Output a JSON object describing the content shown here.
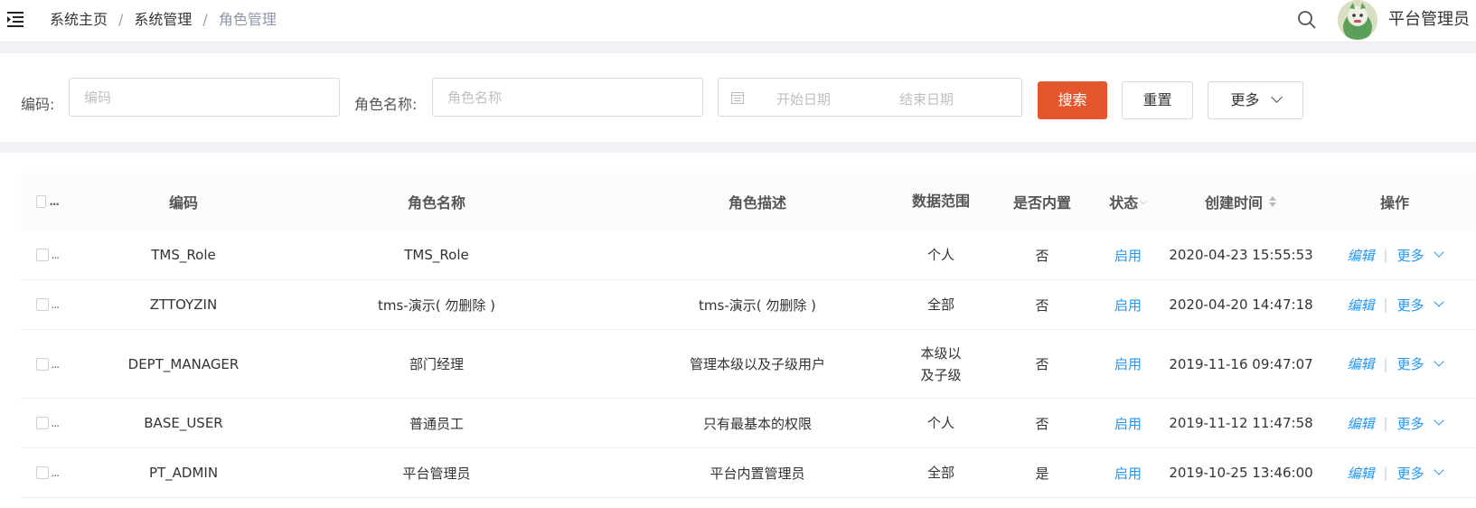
{
  "breadcrumb": {
    "home": "系统主页",
    "system": "系统管理",
    "current": "角色管理",
    "separator": "/"
  },
  "user": {
    "name": "平台管理员"
  },
  "filters": {
    "code_label": "编码:",
    "code_placeholder": "编码",
    "name_label": "角色名称:",
    "name_placeholder": "角色名称",
    "date_start_placeholder": "开始日期",
    "date_end_placeholder": "结束日期",
    "search_button": "搜索",
    "reset_button": "重置",
    "more_button": "更多"
  },
  "table": {
    "headers": {
      "code": "编码",
      "name": "角色名称",
      "desc": "角色描述",
      "range": "数据范围",
      "builtin": "是否内置",
      "status": "状态",
      "created": "创建时间",
      "ops": "操作"
    },
    "row_ellipsis": "...",
    "rows": [
      {
        "code": "TMS_Role",
        "name": "TMS_Role",
        "desc": "",
        "range": "个人",
        "builtin": "否",
        "status": "启用",
        "created": "2020-04-23 15:55:53",
        "edit": "编辑",
        "more": "更多"
      },
      {
        "code": "ZTTOYZIN",
        "name": "tms-演示( 勿删除 )",
        "desc": "tms-演示( 勿删除 )",
        "range": "全部",
        "builtin": "否",
        "status": "启用",
        "created": "2020-04-20 14:47:18",
        "edit": "编辑",
        "more": "更多"
      },
      {
        "code": "DEPT_MANAGER",
        "name": "部门经理",
        "desc": "管理本级以及子级用户",
        "range": "本级以及子级",
        "builtin": "否",
        "status": "启用",
        "created": "2019-11-16 09:47:07",
        "edit": "编辑",
        "more": "更多"
      },
      {
        "code": "BASE_USER",
        "name": "普通员工",
        "desc": "只有最基本的权限",
        "range": "个人",
        "builtin": "否",
        "status": "启用",
        "created": "2019-11-12 11:47:58",
        "edit": "编辑",
        "more": "更多"
      },
      {
        "code": "PT_ADMIN",
        "name": "平台管理员",
        "desc": "平台内置管理员",
        "range": "全部",
        "builtin": "是",
        "status": "启用",
        "created": "2019-10-25 13:46:00",
        "edit": "编辑",
        "more": "更多"
      }
    ]
  },
  "colors": {
    "primary": "#e4572e",
    "link": "#2196f3",
    "breadcrumb_current": "#8c97a8"
  },
  "icons": {
    "menu": "menu-fold-icon",
    "search": "search-icon",
    "calendar": "calendar-icon",
    "sort": "sort-icon",
    "filter": "filter-icon",
    "chevron": "chevron-down-icon"
  }
}
